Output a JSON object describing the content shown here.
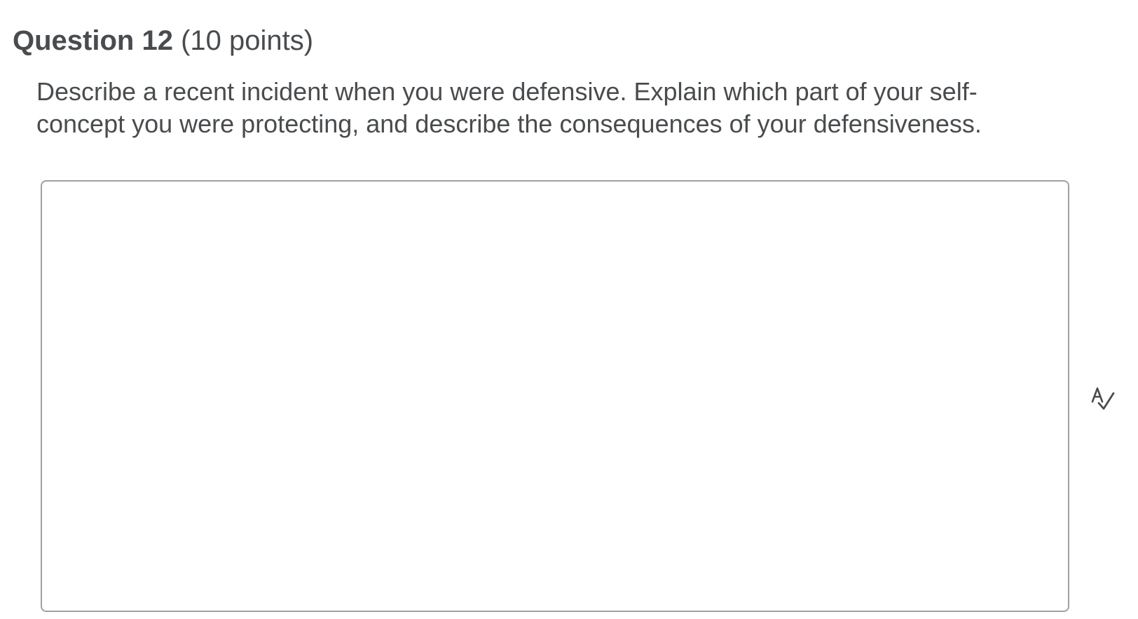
{
  "question": {
    "title": "Question 12",
    "points": "(10 points)",
    "prompt": "Describe a recent incident when you were defensive. Explain which part of your self-concept you were protecting, and describe the consequences of your defensiveness."
  },
  "answer": {
    "value": "",
    "placeholder": ""
  },
  "icons": {
    "spellcheck": "spellcheck-icon"
  },
  "colors": {
    "text": "#494c4e",
    "border": "#9ea1a4"
  }
}
